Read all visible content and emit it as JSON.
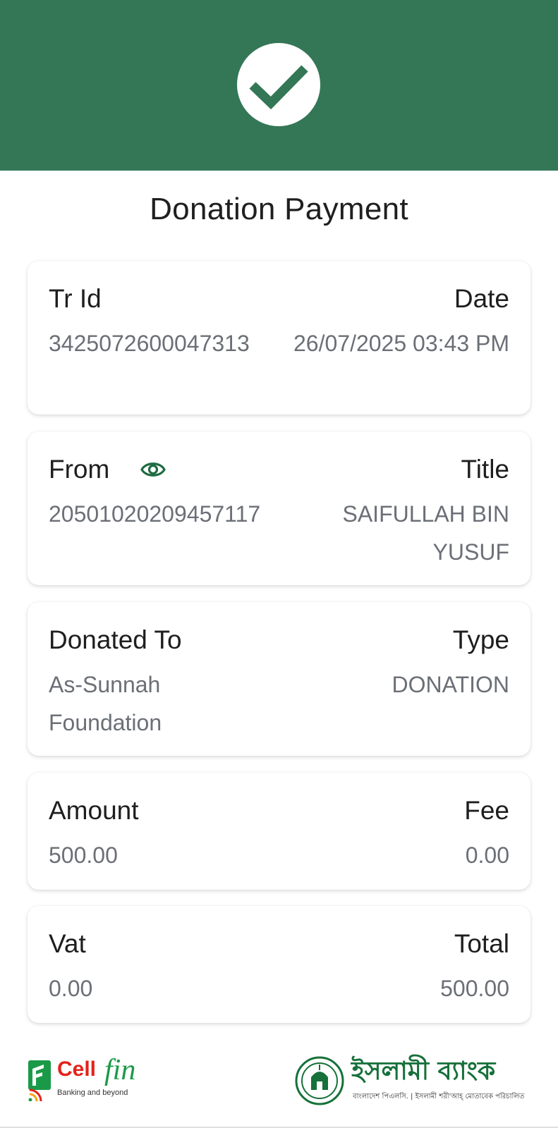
{
  "header": {
    "icon": "checkmark-icon",
    "color": "#347756"
  },
  "page_title": "Donation Payment",
  "cards": {
    "transaction": {
      "left_label": "Tr Id",
      "left_value": "3425072600047313",
      "right_label": "Date",
      "right_value": "26/07/2025 03:43 PM"
    },
    "from": {
      "left_label": "From",
      "left_value": "20501020209457117",
      "right_label": "Title",
      "right_value": "SAIFULLAH BIN YUSUF",
      "icon": "eye-icon"
    },
    "donation": {
      "left_label": "Donated To",
      "left_value": "As-Sunnah Foundation",
      "right_label": "Type",
      "right_value": "DONATION"
    },
    "amount": {
      "left_label": "Amount",
      "left_value": "500.00",
      "right_label": "Fee",
      "right_value": "0.00"
    },
    "vat": {
      "left_label": "Vat",
      "left_value": "0.00",
      "right_label": "Total",
      "right_value": "500.00"
    }
  },
  "footer": {
    "cellfin_logo": {
      "part1": "Cell",
      "part2": "fin",
      "tagline": "Banking and beyond"
    },
    "bank_logo": {
      "name": "ইসলামী ব্যাংক",
      "subtitle": "বাংলাদেশ পিএলসি. | ইসলামী শরী'আহ্ মোতাবেক পরিচালিত"
    }
  },
  "colors": {
    "brand_green": "#347756",
    "label_text": "#1e1e1e",
    "value_text": "#6b6f76"
  }
}
